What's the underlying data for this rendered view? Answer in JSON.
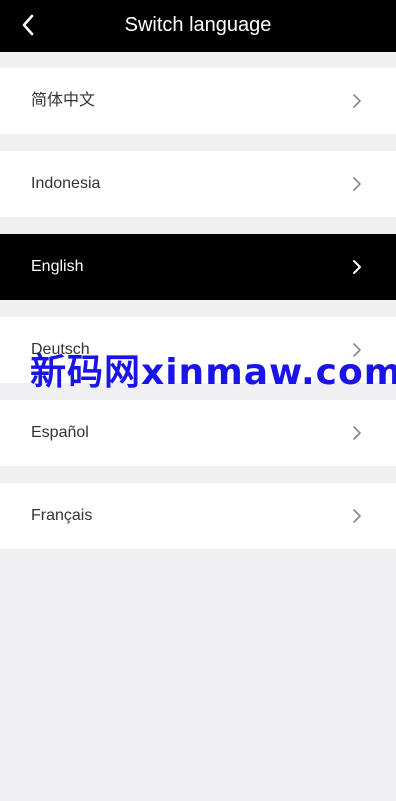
{
  "header": {
    "title": "Switch language",
    "back_icon": "chevron-left-icon"
  },
  "languages": [
    {
      "label": "简体中文",
      "selected": false
    },
    {
      "label": "Indonesia",
      "selected": false
    },
    {
      "label": "English",
      "selected": true
    },
    {
      "label": "Deutsch",
      "selected": false
    },
    {
      "label": "Español",
      "selected": false
    },
    {
      "label": "Français",
      "selected": false
    }
  ],
  "watermark": "新码网xinmaw.com",
  "colors": {
    "header_bg": "#000000",
    "page_bg": "#f0f0f2",
    "selected_bg": "#000000",
    "watermark": "#1a14e6"
  }
}
